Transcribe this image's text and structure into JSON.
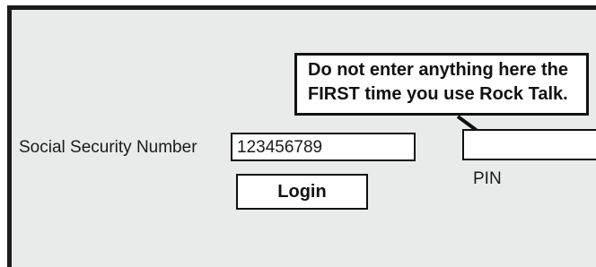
{
  "callout": {
    "line1": "Do not enter anything here the",
    "line2": "FIRST time you use Rock Talk."
  },
  "login_form": {
    "ssn_label": "Social Security Number",
    "ssn_value": "123456789",
    "pin_label": "PIN",
    "pin_value": "",
    "login_button_label": "Login"
  },
  "colors": {
    "panel_background": "#e9ebea",
    "border": "#111111",
    "field_background": "#ffffff"
  }
}
